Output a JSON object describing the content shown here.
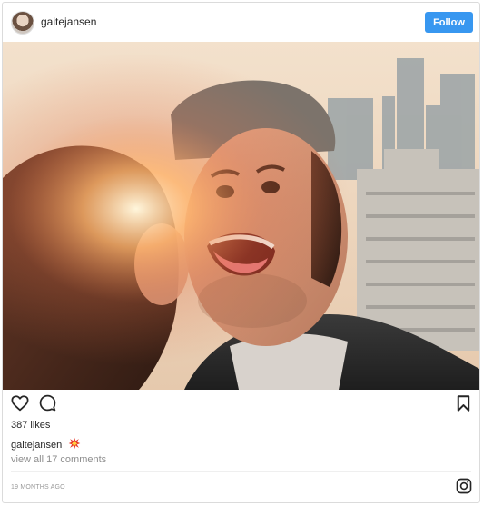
{
  "post": {
    "username": "gaitejansen",
    "follow_label": "Follow",
    "likes": "387 likes",
    "caption_user": "gaitejansen",
    "caption_emoji": "collision-emoji",
    "view_comments": "view all 17 comments",
    "timestamp": "19 MONTHS AGO"
  },
  "icons": {
    "like": "heart-icon",
    "comment": "comment-icon",
    "save": "bookmark-icon",
    "brand": "instagram-icon"
  },
  "colors": {
    "follow_button": "#3897f0",
    "text": "#262626",
    "muted": "#8e8e8e",
    "border": "#dbdbdb"
  }
}
